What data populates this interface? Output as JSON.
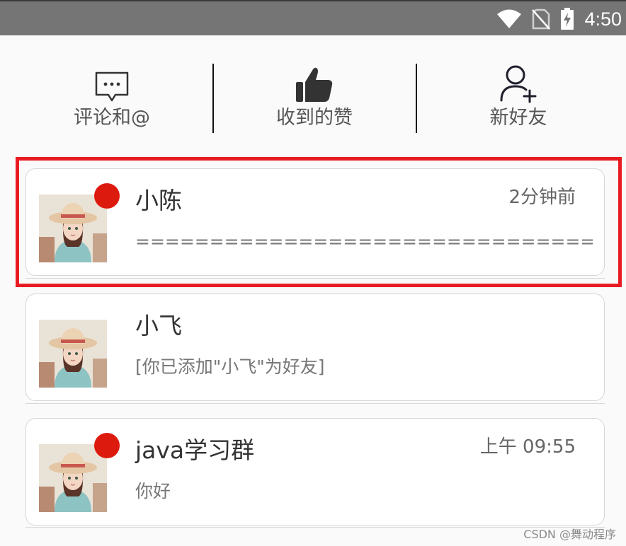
{
  "status_bar": {
    "time": "4:50",
    "icons": [
      "wifi-icon",
      "no-sim-icon",
      "battery-charging-icon"
    ]
  },
  "actions": [
    {
      "label": "评论和@",
      "icon": "comment-bubble-icon"
    },
    {
      "label": "收到的赞",
      "icon": "thumbs-up-icon"
    },
    {
      "label": "新好友",
      "icon": "add-friend-icon"
    }
  ],
  "conversations": [
    {
      "name": "小陈",
      "time": "2分钟前",
      "message": "==========================================",
      "unread": true
    },
    {
      "name": "小飞",
      "time": "",
      "message": "[你已添加\"小飞\"为好友]",
      "unread": false
    },
    {
      "name": "java学习群",
      "time": "上午 09:55",
      "message": "你好",
      "unread": true
    }
  ],
  "watermark": "CSDN @舞动程序",
  "colors": {
    "status_bar": "#757575",
    "badge": "#dd1a0e",
    "highlight": "#e81b23",
    "background": "#fafafa"
  }
}
